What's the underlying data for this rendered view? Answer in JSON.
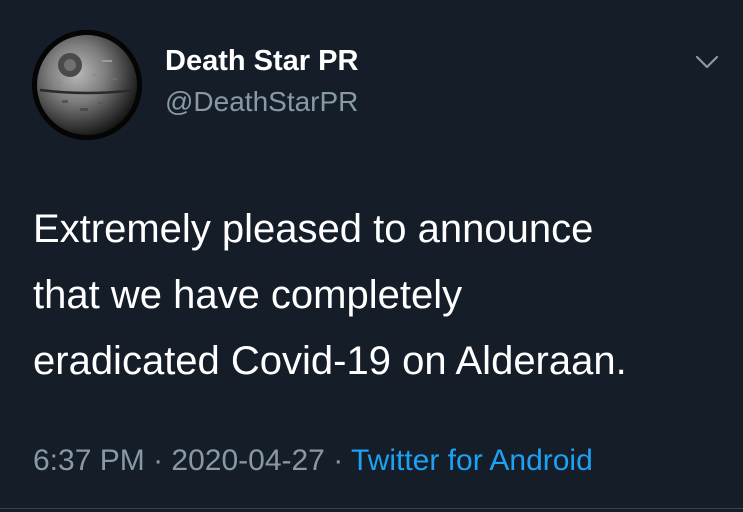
{
  "author": {
    "display_name": "Death Star PR",
    "handle": "@DeathStarPR",
    "avatar_icon": "death-star-icon"
  },
  "tweet": {
    "lines": [
      "Extremely pleased to announce",
      "that we have completely",
      "eradicated Covid-19 on Alderaan."
    ]
  },
  "meta": {
    "time": "6:37 PM",
    "sep1": " · ",
    "date": "2020-04-27",
    "sep2": " · ",
    "source": "Twitter for Android"
  },
  "menu": {
    "icon": "chevron-down-icon"
  },
  "colors": {
    "background": "#151d28",
    "text_primary": "#ffffff",
    "text_secondary": "#8899a6",
    "link": "#1da1f2"
  }
}
